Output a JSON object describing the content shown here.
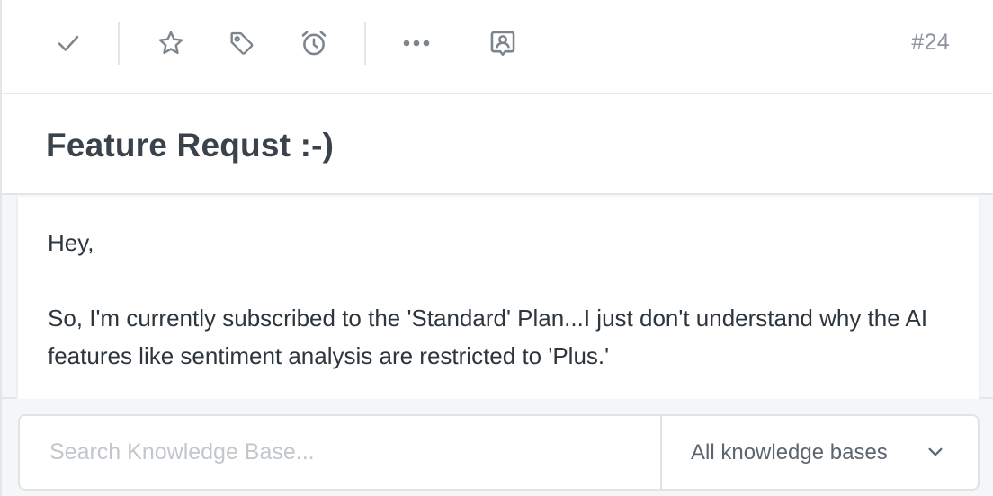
{
  "toolbar": {
    "icons": [
      "check-icon",
      "star-icon",
      "tag-icon",
      "alarm-clock-icon",
      "more-dots-icon",
      "assign-user-icon"
    ],
    "ticket_number": "#24"
  },
  "ticket": {
    "title": "Feature Requst :-)"
  },
  "message": {
    "paragraphs": [
      "Hey,",
      "So, I'm currently subscribed to the 'Standard' Plan...I just don't understand why the AI features like sentiment analysis are restricted to 'Plus.'"
    ]
  },
  "search": {
    "placeholder": "Search Knowledge Base...",
    "value": "",
    "kb_filter": {
      "selected": "All knowledge bases"
    }
  },
  "colors": {
    "icon": "#7c848c",
    "title": "#3a434c",
    "text": "#2d353d",
    "border": "#e3e6e9",
    "background": "#f5f6f7"
  }
}
